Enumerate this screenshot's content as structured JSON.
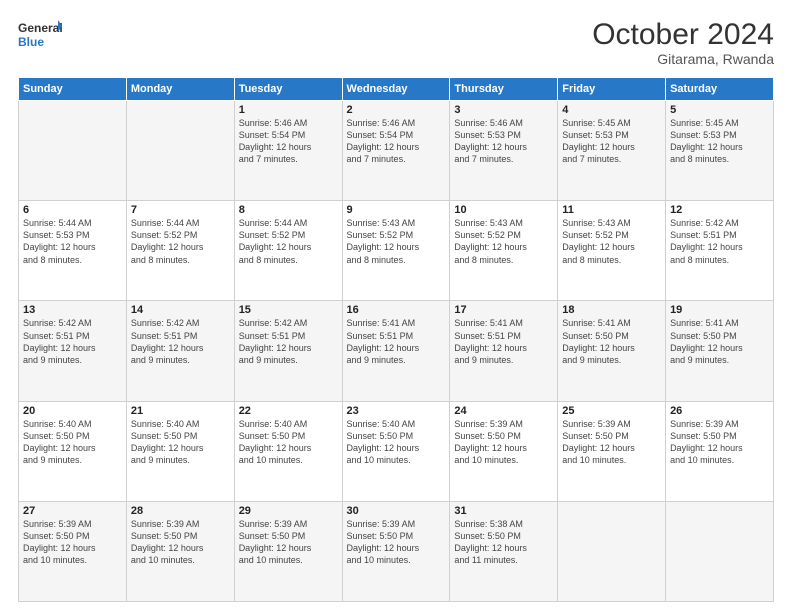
{
  "header": {
    "logo_line1": "General",
    "logo_line2": "Blue",
    "month": "October 2024",
    "location": "Gitarama, Rwanda"
  },
  "weekdays": [
    "Sunday",
    "Monday",
    "Tuesday",
    "Wednesday",
    "Thursday",
    "Friday",
    "Saturday"
  ],
  "weeks": [
    [
      {
        "day": "",
        "info": ""
      },
      {
        "day": "",
        "info": ""
      },
      {
        "day": "1",
        "info": "Sunrise: 5:46 AM\nSunset: 5:54 PM\nDaylight: 12 hours\nand 7 minutes."
      },
      {
        "day": "2",
        "info": "Sunrise: 5:46 AM\nSunset: 5:54 PM\nDaylight: 12 hours\nand 7 minutes."
      },
      {
        "day": "3",
        "info": "Sunrise: 5:46 AM\nSunset: 5:53 PM\nDaylight: 12 hours\nand 7 minutes."
      },
      {
        "day": "4",
        "info": "Sunrise: 5:45 AM\nSunset: 5:53 PM\nDaylight: 12 hours\nand 7 minutes."
      },
      {
        "day": "5",
        "info": "Sunrise: 5:45 AM\nSunset: 5:53 PM\nDaylight: 12 hours\nand 8 minutes."
      }
    ],
    [
      {
        "day": "6",
        "info": "Sunrise: 5:44 AM\nSunset: 5:53 PM\nDaylight: 12 hours\nand 8 minutes."
      },
      {
        "day": "7",
        "info": "Sunrise: 5:44 AM\nSunset: 5:52 PM\nDaylight: 12 hours\nand 8 minutes."
      },
      {
        "day": "8",
        "info": "Sunrise: 5:44 AM\nSunset: 5:52 PM\nDaylight: 12 hours\nand 8 minutes."
      },
      {
        "day": "9",
        "info": "Sunrise: 5:43 AM\nSunset: 5:52 PM\nDaylight: 12 hours\nand 8 minutes."
      },
      {
        "day": "10",
        "info": "Sunrise: 5:43 AM\nSunset: 5:52 PM\nDaylight: 12 hours\nand 8 minutes."
      },
      {
        "day": "11",
        "info": "Sunrise: 5:43 AM\nSunset: 5:52 PM\nDaylight: 12 hours\nand 8 minutes."
      },
      {
        "day": "12",
        "info": "Sunrise: 5:42 AM\nSunset: 5:51 PM\nDaylight: 12 hours\nand 8 minutes."
      }
    ],
    [
      {
        "day": "13",
        "info": "Sunrise: 5:42 AM\nSunset: 5:51 PM\nDaylight: 12 hours\nand 9 minutes."
      },
      {
        "day": "14",
        "info": "Sunrise: 5:42 AM\nSunset: 5:51 PM\nDaylight: 12 hours\nand 9 minutes."
      },
      {
        "day": "15",
        "info": "Sunrise: 5:42 AM\nSunset: 5:51 PM\nDaylight: 12 hours\nand 9 minutes."
      },
      {
        "day": "16",
        "info": "Sunrise: 5:41 AM\nSunset: 5:51 PM\nDaylight: 12 hours\nand 9 minutes."
      },
      {
        "day": "17",
        "info": "Sunrise: 5:41 AM\nSunset: 5:51 PM\nDaylight: 12 hours\nand 9 minutes."
      },
      {
        "day": "18",
        "info": "Sunrise: 5:41 AM\nSunset: 5:50 PM\nDaylight: 12 hours\nand 9 minutes."
      },
      {
        "day": "19",
        "info": "Sunrise: 5:41 AM\nSunset: 5:50 PM\nDaylight: 12 hours\nand 9 minutes."
      }
    ],
    [
      {
        "day": "20",
        "info": "Sunrise: 5:40 AM\nSunset: 5:50 PM\nDaylight: 12 hours\nand 9 minutes."
      },
      {
        "day": "21",
        "info": "Sunrise: 5:40 AM\nSunset: 5:50 PM\nDaylight: 12 hours\nand 9 minutes."
      },
      {
        "day": "22",
        "info": "Sunrise: 5:40 AM\nSunset: 5:50 PM\nDaylight: 12 hours\nand 10 minutes."
      },
      {
        "day": "23",
        "info": "Sunrise: 5:40 AM\nSunset: 5:50 PM\nDaylight: 12 hours\nand 10 minutes."
      },
      {
        "day": "24",
        "info": "Sunrise: 5:39 AM\nSunset: 5:50 PM\nDaylight: 12 hours\nand 10 minutes."
      },
      {
        "day": "25",
        "info": "Sunrise: 5:39 AM\nSunset: 5:50 PM\nDaylight: 12 hours\nand 10 minutes."
      },
      {
        "day": "26",
        "info": "Sunrise: 5:39 AM\nSunset: 5:50 PM\nDaylight: 12 hours\nand 10 minutes."
      }
    ],
    [
      {
        "day": "27",
        "info": "Sunrise: 5:39 AM\nSunset: 5:50 PM\nDaylight: 12 hours\nand 10 minutes."
      },
      {
        "day": "28",
        "info": "Sunrise: 5:39 AM\nSunset: 5:50 PM\nDaylight: 12 hours\nand 10 minutes."
      },
      {
        "day": "29",
        "info": "Sunrise: 5:39 AM\nSunset: 5:50 PM\nDaylight: 12 hours\nand 10 minutes."
      },
      {
        "day": "30",
        "info": "Sunrise: 5:39 AM\nSunset: 5:50 PM\nDaylight: 12 hours\nand 10 minutes."
      },
      {
        "day": "31",
        "info": "Sunrise: 5:38 AM\nSunset: 5:50 PM\nDaylight: 12 hours\nand 11 minutes."
      },
      {
        "day": "",
        "info": ""
      },
      {
        "day": "",
        "info": ""
      }
    ]
  ]
}
